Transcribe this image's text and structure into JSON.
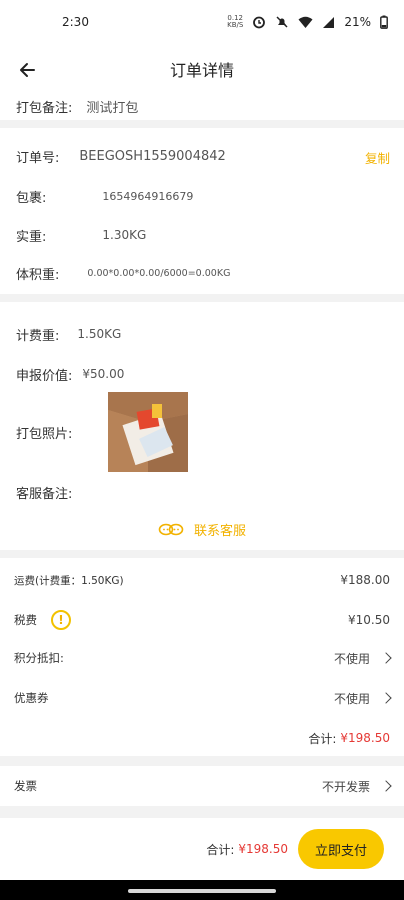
{
  "status_bar": {
    "time": "2:30",
    "net_speed_top": "0.12",
    "net_speed_bottom": "KB/S",
    "battery": "21%"
  },
  "header": {
    "title": "订单详情"
  },
  "packing_note": {
    "label": "打包备注:",
    "value": "测试打包"
  },
  "order": {
    "order_no_label": "订单号:",
    "order_no": "BEEGOSH1559004842",
    "copy_label": "复制",
    "package_label": "包裹:",
    "package_value": "1654964916679",
    "actual_weight_label": "实重:",
    "actual_weight": "1.30KG",
    "volume_weight_label": "体积重:",
    "volume_weight": "0.00*0.00*0.00/6000=0.00KG"
  },
  "details": {
    "billing_weight_label": "计费重:",
    "billing_weight": "1.50KG",
    "declared_value_label": "申报价值:",
    "declared_value": "¥50.00",
    "packing_photo_label": "打包照片:",
    "service_note_label": "客服备注:",
    "contact_service": "联系客服"
  },
  "fees": {
    "shipping_label": "运费(计费重：1.50KG)",
    "shipping_value": "¥188.00",
    "tax_label": "税费",
    "tax_value": "¥10.50",
    "points_label": "积分抵扣:",
    "points_value": "不使用",
    "coupon_label": "优惠券",
    "coupon_value": "不使用",
    "total_label": "合计:",
    "total_value": "¥198.50"
  },
  "invoice": {
    "label": "发票",
    "value": "不开发票"
  },
  "bottom": {
    "total_label": "合计:",
    "total_value": "¥198.50",
    "pay_button": "立即支付"
  },
  "colors": {
    "accent_yellow": "#f9c800",
    "price_red": "#e53935",
    "link_yellow": "#f2b200"
  }
}
